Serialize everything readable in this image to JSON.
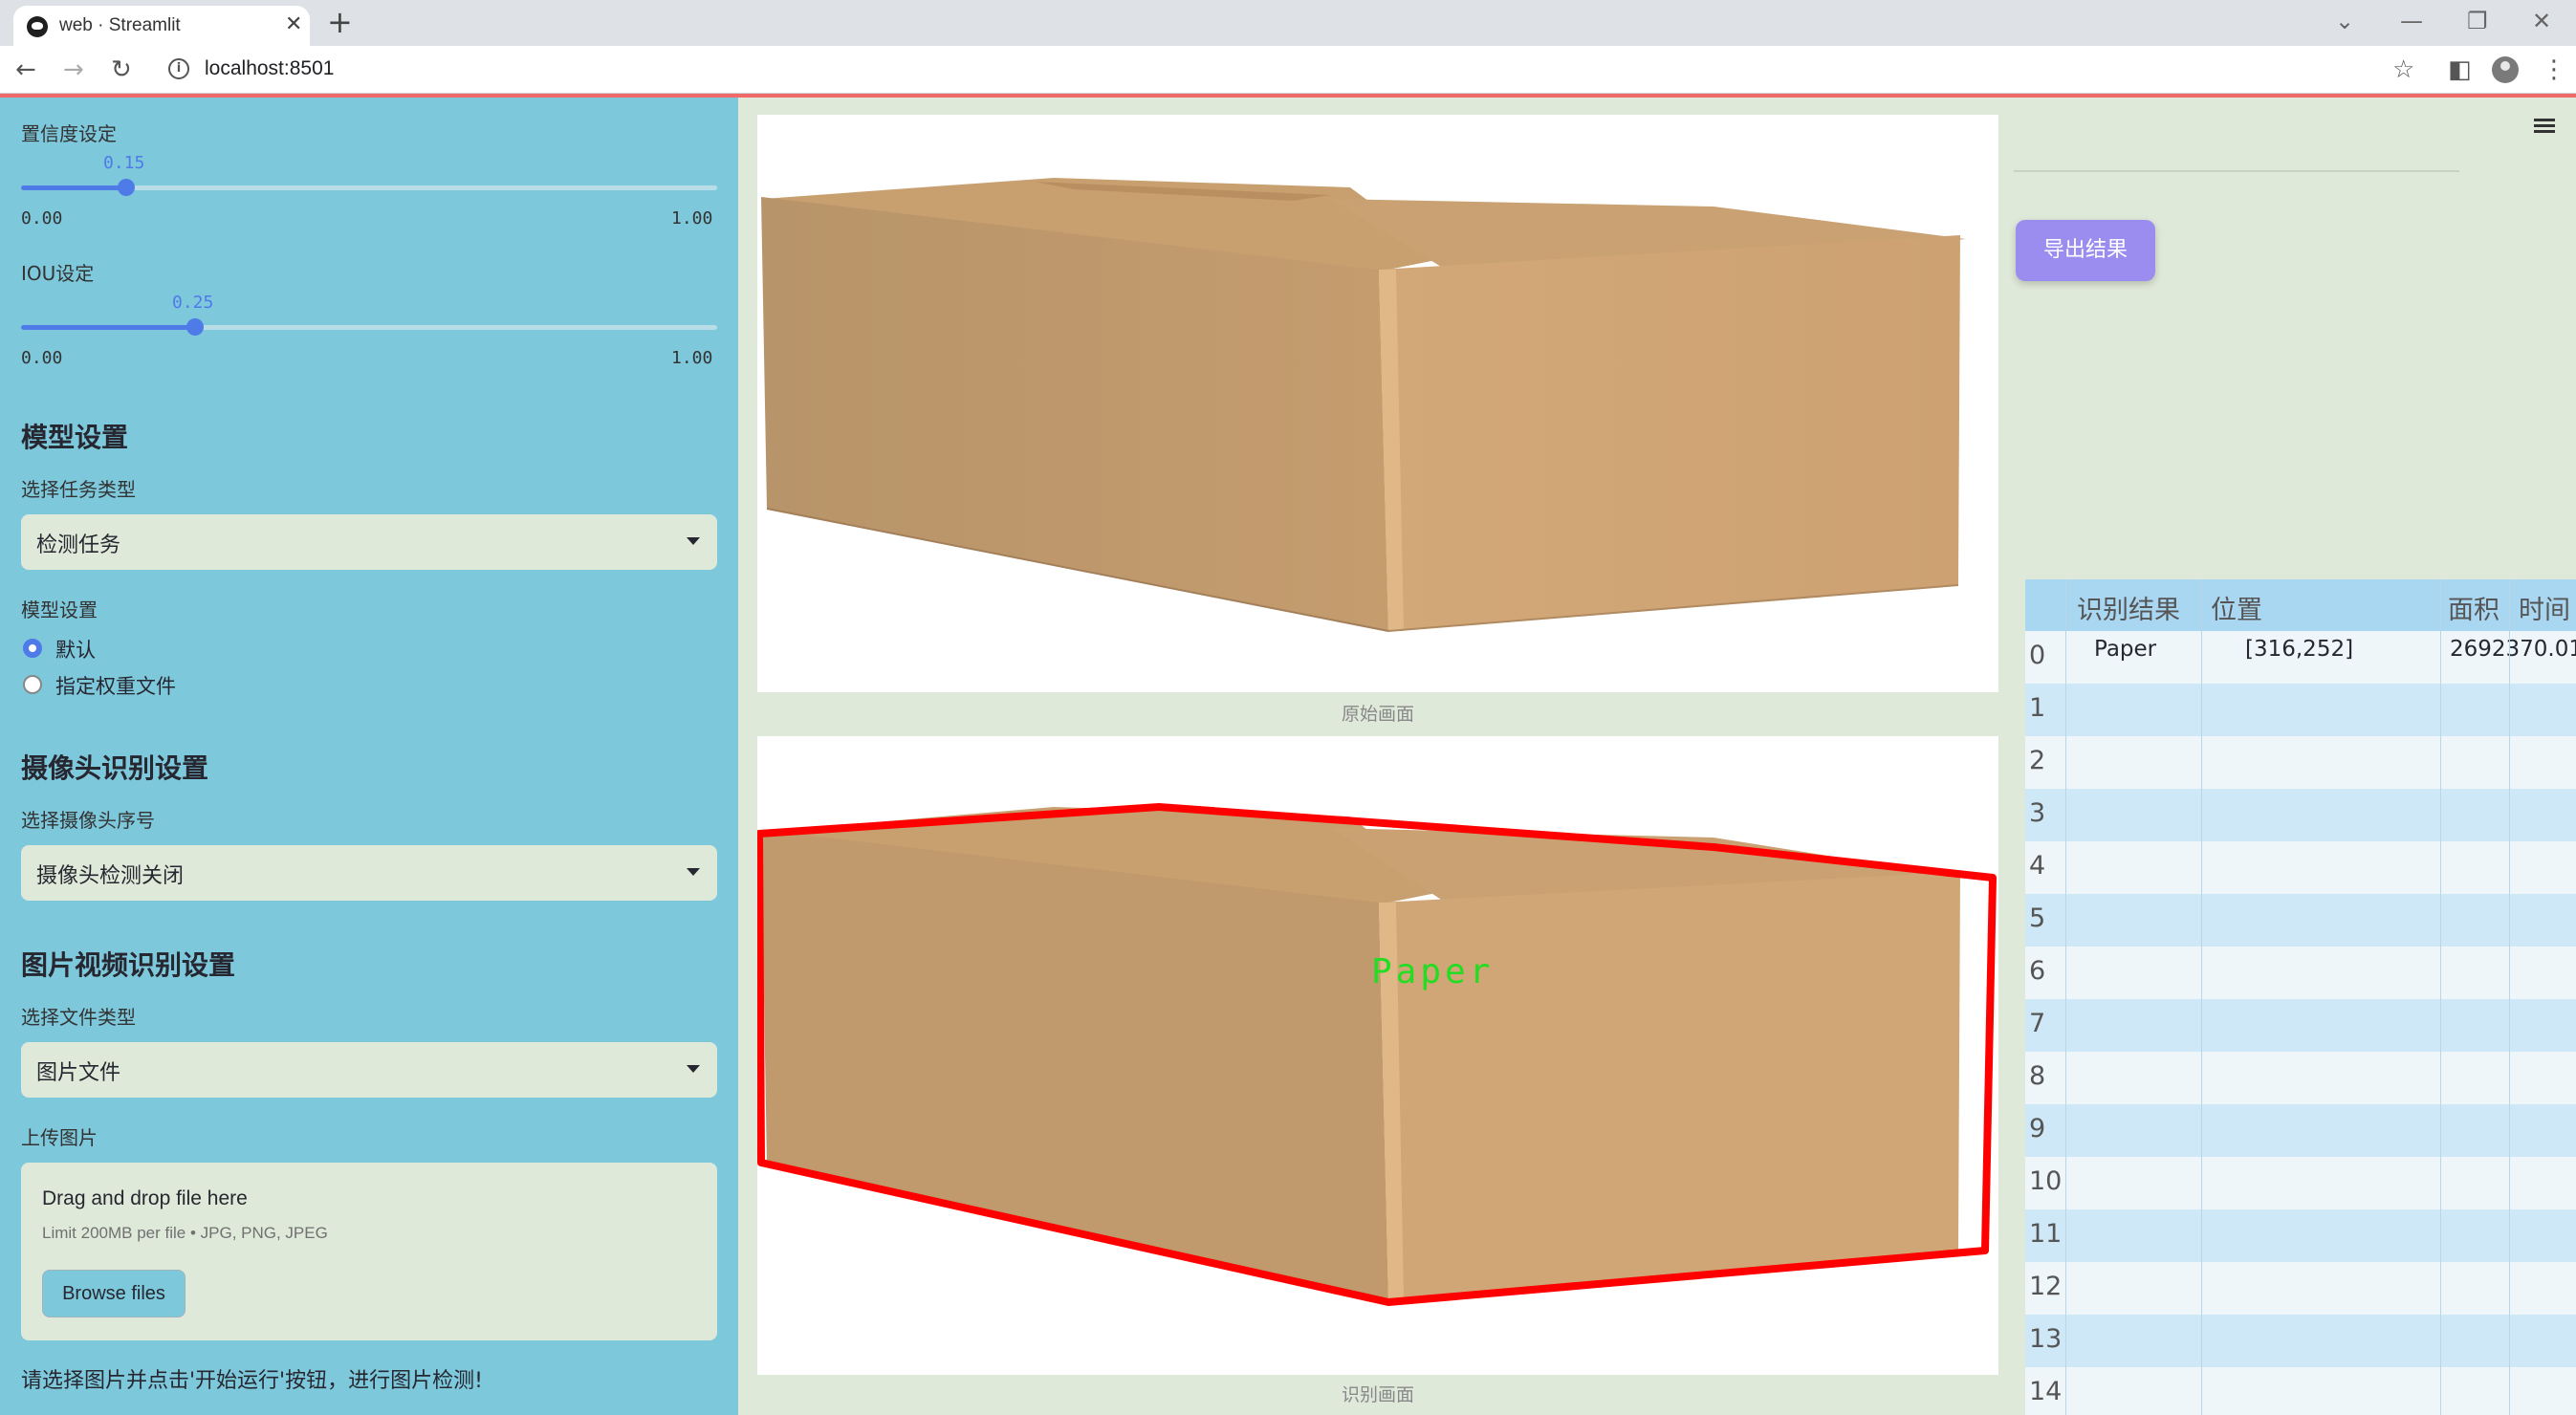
{
  "browser": {
    "tab_title": "web · Streamlit",
    "url": "localhost:8501"
  },
  "sidebar": {
    "confidence": {
      "label": "置信度设定",
      "value": "0.15",
      "min": "0.00",
      "max": "1.00",
      "fraction": 0.15
    },
    "iou": {
      "label": "IOU设定",
      "value": "0.25",
      "min": "0.00",
      "max": "1.00",
      "fraction": 0.25
    },
    "model_section": {
      "title": "模型设置",
      "task_label": "选择任务类型",
      "task_value": "检测任务",
      "model_label": "模型设置",
      "options": [
        {
          "label": "默认",
          "selected": true
        },
        {
          "label": "指定权重文件",
          "selected": false
        }
      ]
    },
    "camera_section": {
      "title": "摄像头识别设置",
      "camera_label": "选择摄像头序号",
      "camera_value": "摄像头检测关闭"
    },
    "media_section": {
      "title": "图片视频识别设置",
      "file_type_label": "选择文件类型",
      "file_type_value": "图片文件",
      "upload_label": "上传图片",
      "drop_title": "Drag and drop file here",
      "drop_limit": "Limit 200MB per file • JPG, PNG, JPEG",
      "browse_label": "Browse files"
    },
    "hint": "请选择图片并点击'开始运行'按钮，进行图片检测!"
  },
  "main": {
    "original_caption": "原始画面",
    "result_caption": "识别画面",
    "detection_label": "Paper",
    "box_color": "#ff0000",
    "label_color": "#22dd22"
  },
  "right": {
    "export_label": "导出结果",
    "table": {
      "columns": [
        "识别结果",
        "位置",
        "面积",
        "时间"
      ],
      "rows": [
        {
          "index": "0",
          "result": "Paper",
          "position": "[316,252]",
          "area": "2692370.01",
          "time": ""
        },
        {
          "index": "1"
        },
        {
          "index": "2"
        },
        {
          "index": "3"
        },
        {
          "index": "4"
        },
        {
          "index": "5"
        },
        {
          "index": "6"
        },
        {
          "index": "7"
        },
        {
          "index": "8"
        },
        {
          "index": "9"
        },
        {
          "index": "10"
        },
        {
          "index": "11"
        },
        {
          "index": "12"
        },
        {
          "index": "13"
        },
        {
          "index": "14"
        }
      ]
    }
  }
}
